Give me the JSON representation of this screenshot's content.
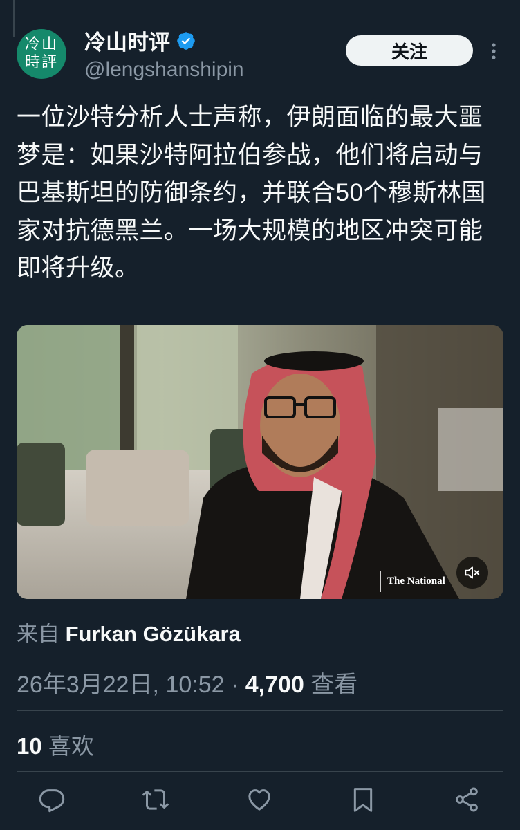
{
  "header": {
    "avatar_text": "冷山\n時評",
    "display_name": "冷山时评",
    "handle": "@lengshanshipin",
    "follow_label": "关注"
  },
  "tweet": {
    "text": "一位沙特分析人士声称，伊朗面临的最大噩梦是：如果沙特阿拉伯参战，他们将启动与巴基斯坦的防御条约，并联合50个穆斯林国家对抗德黑兰。一场大规模的地区冲突可能即将升级。",
    "media_watermark": "The National",
    "from_label": "来自",
    "from_name": "Furkan Gözükara",
    "timestamp": "26年3月22日, 10:52",
    "separator": "·",
    "views_count": "4,700",
    "views_label": "查看",
    "likes_count": "10",
    "likes_label": "喜欢"
  },
  "icons": [
    "verified-badge-icon",
    "more-icon",
    "mute-icon",
    "reply-icon",
    "retweet-icon",
    "like-icon",
    "bookmark-icon",
    "share-icon"
  ],
  "colors": {
    "background": "#15202b",
    "text": "#f7f9f9",
    "secondary": "#8b98a5",
    "accent": "#1d9bf0",
    "avatar": "#15896b"
  }
}
